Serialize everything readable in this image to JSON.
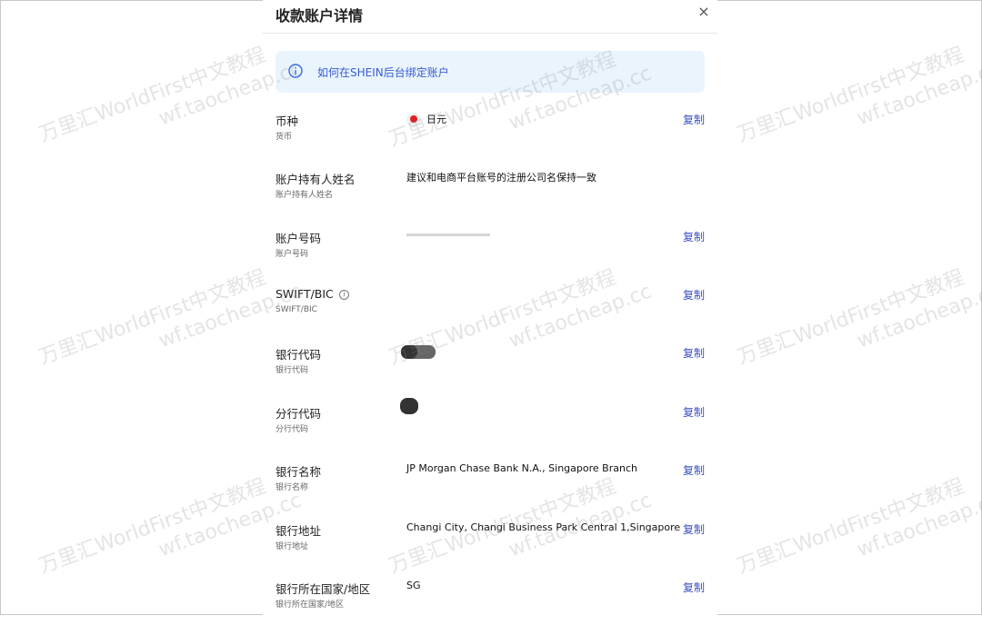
{
  "dialog": {
    "title": "收款账户详情",
    "close_icon": "×"
  },
  "banner": {
    "icon": "info-icon",
    "text": "如何在SHEIN后台绑定账户"
  },
  "copy_label": "复制",
  "rows": [
    {
      "label": "币种",
      "sublabel": "货币",
      "value": "日元",
      "has_copy": true
    },
    {
      "label": "账户持有人姓名",
      "sublabel": "账户持有人姓名",
      "value": "建议和电商平台账号的注册公司名保持一致",
      "has_copy": false
    },
    {
      "label": "账户号码",
      "sublabel": "账户号码",
      "value": "",
      "has_copy": true
    },
    {
      "label": "SWIFT/BIC",
      "sublabel": "SWIFT/BIC",
      "value": "",
      "has_copy": true
    },
    {
      "label": "银行代码",
      "sublabel": "银行代码",
      "value": "",
      "has_copy": true
    },
    {
      "label": "分行代码",
      "sublabel": "分行代码",
      "value": "",
      "has_copy": true
    },
    {
      "label": "银行名称",
      "sublabel": "银行名称",
      "value": "JP Morgan Chase Bank N.A., Singapore Branch",
      "has_copy": true
    },
    {
      "label": "银行地址",
      "sublabel": "银行地址",
      "value": "Changi City, Changi Business Park Central 1,Singapore",
      "has_copy": true
    },
    {
      "label": "银行所在国家/地区",
      "sublabel": "银行所在国家/地区",
      "value": "SG",
      "has_copy": true
    }
  ],
  "watermark": {
    "line1": "万里汇WorldFirst中文教程",
    "line2": "wf.taocheap.cc"
  },
  "colors": {
    "accent": "#3a4fc4",
    "banner_bg": "#e9f4fd",
    "flag_red": "#e02020"
  }
}
